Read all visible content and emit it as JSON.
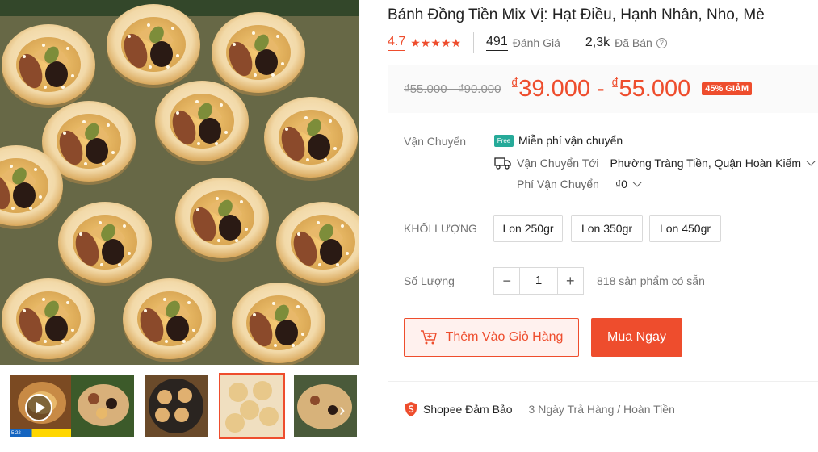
{
  "product": {
    "title": "Bánh Đồng Tiền Mix Vị: Hạt Điều, Hạnh Nhân, Nho, Mè"
  },
  "stats": {
    "rating": "4.7",
    "stars": "★★★★★",
    "reviews_count": "491",
    "reviews_label": "Đánh Giá",
    "sold_count": "2,3k",
    "sold_label": "Đã Bán",
    "help_icon": "?"
  },
  "price": {
    "original_range": "₫55.000 - ₫90.000",
    "currency_symbol": "₫",
    "current_min": "39.000",
    "current_max": "55.000",
    "separator": " - ",
    "discount_badge": "45% GIẢM",
    "accent_color": "#ee4d2d"
  },
  "shipping": {
    "label": "Vận Chuyển",
    "free_badge": "Free",
    "free_text": "Miễn phí vận chuyển",
    "to_label": "Vận Chuyển Tới",
    "to_value": "Phường Tràng Tiền, Quận Hoàn Kiếm",
    "fee_label": "Phí Vận Chuyển",
    "fee_value": "₫0"
  },
  "variation": {
    "label": "KHỐI LƯỢNG",
    "options": [
      "Lon 250gr",
      "Lon 350gr",
      "Lon 450gr"
    ]
  },
  "quantity": {
    "label": "Số Lượng",
    "minus": "−",
    "value": "1",
    "plus": "+",
    "stock_text": "818 sản phẩm có sẵn"
  },
  "actions": {
    "add_to_cart": "Thêm Vào Giỏ Hàng",
    "buy_now": "Mua Ngay"
  },
  "guarantee": {
    "title": "Shopee Đảm Bảo",
    "description": "3 Ngày Trả Hàng / Hoàn Tiền"
  },
  "gallery": {
    "thumbnail_count": 5,
    "active_index": 3,
    "next_arrow": "›",
    "video_badge": "5.22"
  }
}
